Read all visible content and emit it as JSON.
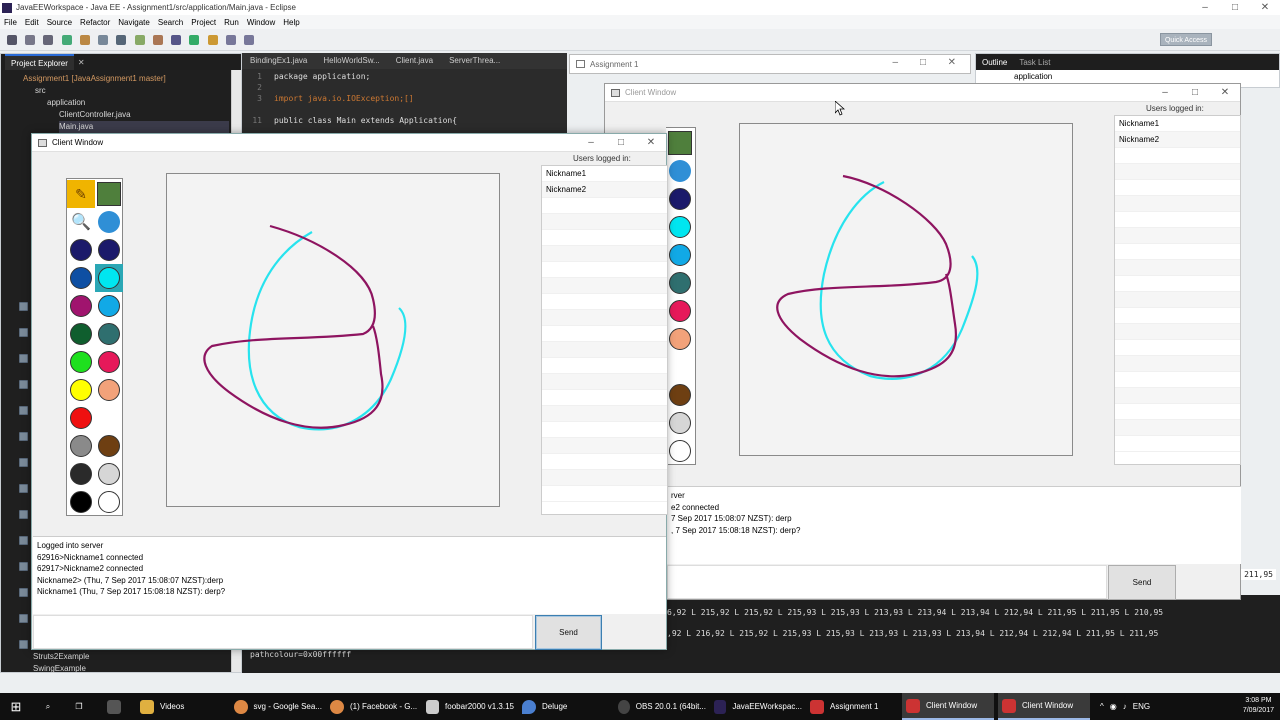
{
  "eclipse": {
    "title": "JavaEEWorkspace - Java EE - Assignment1/src/application/Main.java - Eclipse",
    "menu": [
      "File",
      "Edit",
      "Source",
      "Refactor",
      "Navigate",
      "Search",
      "Project",
      "Run",
      "Window",
      "Help"
    ],
    "quick_access": "Quick Access",
    "project_explorer_tab": "Project Explorer",
    "tree": [
      {
        "label": "Assignment1 [JavaAssignment1 master]",
        "indent": 0
      },
      {
        "label": "src",
        "indent": 1
      },
      {
        "label": "application",
        "indent": 2
      },
      {
        "label": "ClientController.java",
        "indent": 3
      },
      {
        "label": "Main.java",
        "indent": 3
      }
    ],
    "tree_bottom": [
      "Struts2Example",
      "SwingExample"
    ],
    "editor_tabs": [
      "BindingEx1.java",
      "HelloWorldSw...",
      "Client.java",
      "ServerThrea..."
    ],
    "code": [
      {
        "n": "1",
        "t": "package application;"
      },
      {
        "n": "2",
        "t": ""
      },
      {
        "n": "3",
        "t": "import java.io.IOException;[]"
      },
      {
        "n": "",
        "t": ""
      },
      {
        "n": "11",
        "t": "public class Main extends Application{"
      }
    ],
    "outline_tabs": [
      "Outline",
      "Task List"
    ],
    "outline_item": "application",
    "console_lines": [
      "6,92 L 215,92  L 215,92  L 215,93  L 215,93  L 213,93  L 213,94  L 213,94  L 212,94  L 211,95  L 211,95  L 210,95",
      ",92 L 216,92  L 215,92  L 215,93  L 215,93  L 213,93  L 213,93  L 213,94  L 212,94  L 212,94  L 211,95  L 211,95",
      "pathcolour=0x00ffffff"
    ],
    "console_side": "211,95"
  },
  "assignment_window": {
    "title": "Assignment 1"
  },
  "client_back": {
    "title": "Client Window",
    "users_title": "Users logged in:",
    "users": [
      "Nickname1",
      "Nickname2"
    ],
    "messages": [
      "rver",
      "e2 connected",
      "7 Sep 2017 15:08:07 NZST): derp",
      ", 7 Sep 2017 15:08:18 NZST): derp?"
    ],
    "send": "Send"
  },
  "client_front": {
    "title": "Client Window",
    "users_title": "Users logged in:",
    "users": [
      "Nickname1",
      "Nickname2"
    ],
    "messages": [
      "Logged into server",
      "62916>Nickname1 connected",
      "62917>Nickname2 connected",
      "Nickname2> (Thu, 7 Sep 2017 15:08:07 NZST):derp",
      "Nickname1 (Thu, 7 Sep 2017 15:08:18 NZST): derp?"
    ],
    "send": "Send"
  },
  "palette_colors": {
    "c1": "#1b1a6a",
    "c2": "#1b1a6a",
    "c3": "#0e4fa3",
    "c4": "#00e6f0",
    "c5": "#a0146e",
    "c6": "#11a9e6",
    "c7": "#0f5e2e",
    "c8": "#2f6f6f",
    "c9": "#1ee01e",
    "c10": "#e6195a",
    "c11": "#ffff00",
    "c12": "#f2a27a",
    "c13": "#ef1010",
    "c15": "#8a8a8a",
    "c16": "#6e3f12",
    "c17": "#2a2a2a",
    "c18": "#d6d6d6",
    "c19": "#000000",
    "c20": "#ffffff"
  },
  "stroke_colors": {
    "purple": "#8e1460",
    "cyan": "#27e3ee"
  },
  "taskbar": {
    "items": [
      "Videos",
      "svg - Google Sea...",
      "(1) Facebook - G...",
      "foobar2000 v1.3.15",
      "Deluge",
      "OBS 20.0.1 (64bit...",
      "JavaEEWorkspac...",
      "Assignment 1",
      "Client Window",
      "Client Window"
    ],
    "lang": "ENG",
    "time": "3:08 PM",
    "date": "7/09/2017"
  }
}
